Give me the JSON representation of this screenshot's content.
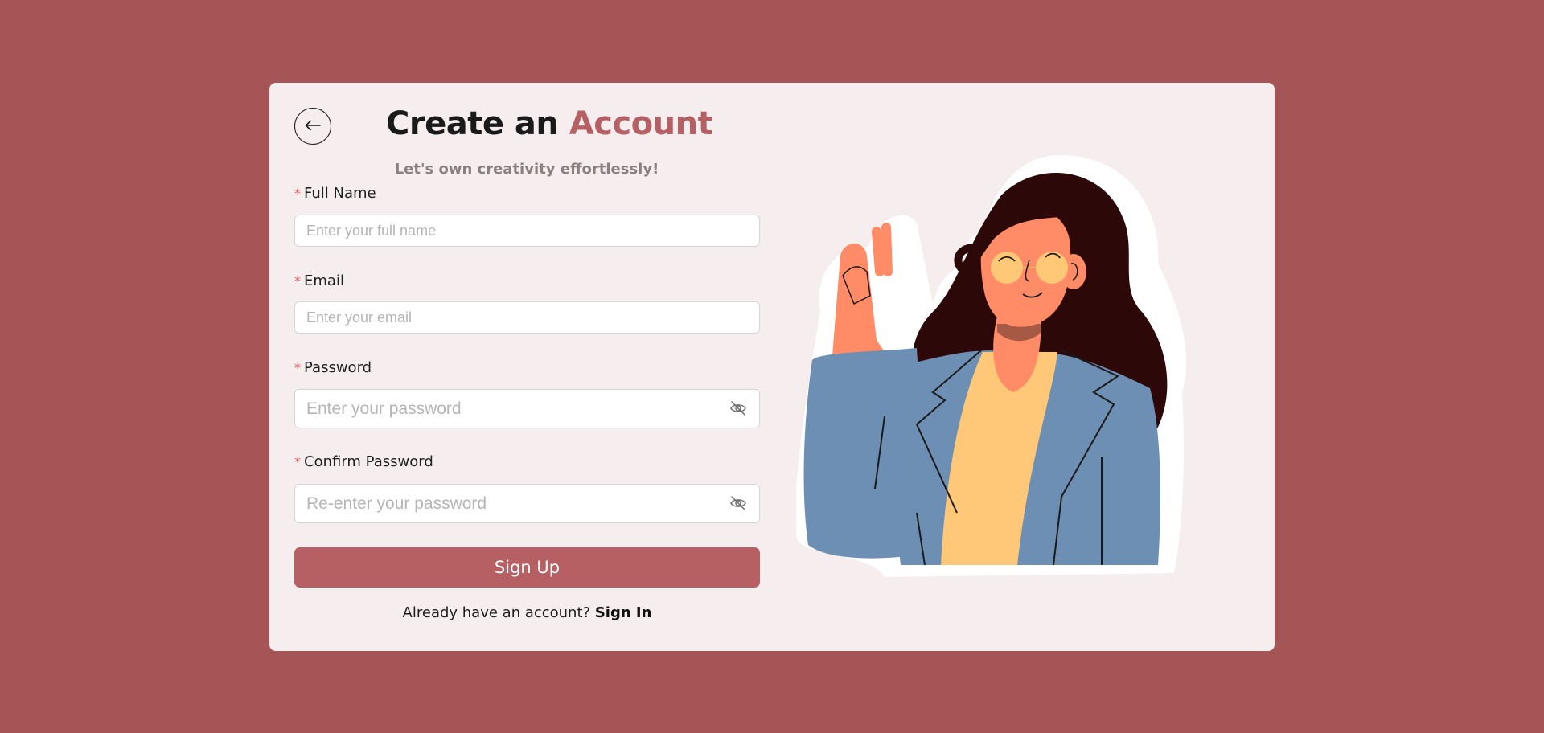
{
  "header": {
    "title_part1": "Create an",
    "title_part2": "Account",
    "subtitle": "Let's own creativity effortlessly!"
  },
  "form": {
    "required_mark": "*",
    "full_name": {
      "label": "Full Name",
      "placeholder": "Enter your full name",
      "value": ""
    },
    "email": {
      "label": "Email",
      "placeholder": "Enter your email",
      "value": ""
    },
    "password": {
      "label": "Password",
      "placeholder": "Enter your password",
      "value": ""
    },
    "confirm_password": {
      "label": "Confirm Password",
      "placeholder": "Re-enter your password",
      "value": ""
    },
    "submit_label": "Sign Up"
  },
  "footer": {
    "prompt": "Already have an account?",
    "link_label": "Sign In"
  },
  "icons": {
    "back": "arrow-left-icon",
    "password_toggle": "eye-off-icon"
  },
  "colors": {
    "background": "#a55556",
    "card": "#f6eeee",
    "accent": "#b56064",
    "button": "#b66064"
  }
}
